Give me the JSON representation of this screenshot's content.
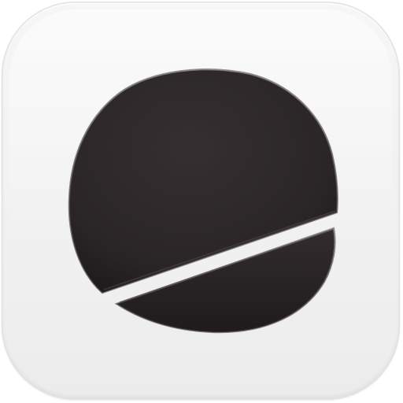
{
  "icon": {
    "name": "split-disc-app-icon",
    "tile_color": "#f2f2f2",
    "disc_color": "#2b2628"
  }
}
